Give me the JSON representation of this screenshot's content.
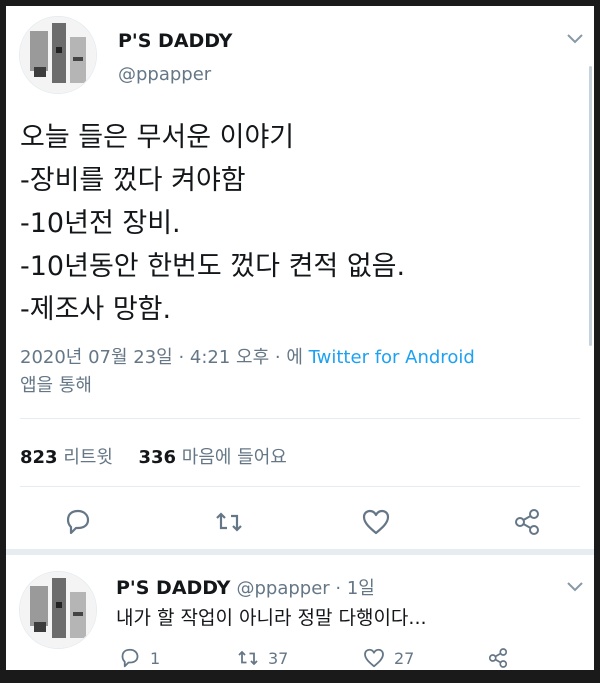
{
  "tweet": {
    "author_name": "P'S DADDY",
    "author_handle": "@ppapper",
    "lines": [
      "오늘 들은 무서운 이야기",
      "-장비를 껐다 켜야함",
      "-10년전 장비.",
      "-10년동안 한번도 껐다 켠적 없음.",
      "-제조사 망함."
    ],
    "timestamp": "2020년 07월 23일 · 4:21 오후 · 에",
    "client": "Twitter for Android",
    "client_suffix": "앱을 통해",
    "retweet_count": "823",
    "retweet_label": "리트윗",
    "like_count": "336",
    "like_label": "마음에 들어요"
  },
  "reply": {
    "author_name": "P'S DADDY",
    "author_handle": "@ppapper · 1일",
    "text": "내가 할 작업이 아니라 정말 다행이다...",
    "reply_count": "1",
    "retweet_count": "37",
    "like_count": "27"
  },
  "colors": {
    "accent": "#1da1f2",
    "secondary_text": "#657786",
    "icon": "#657786"
  }
}
